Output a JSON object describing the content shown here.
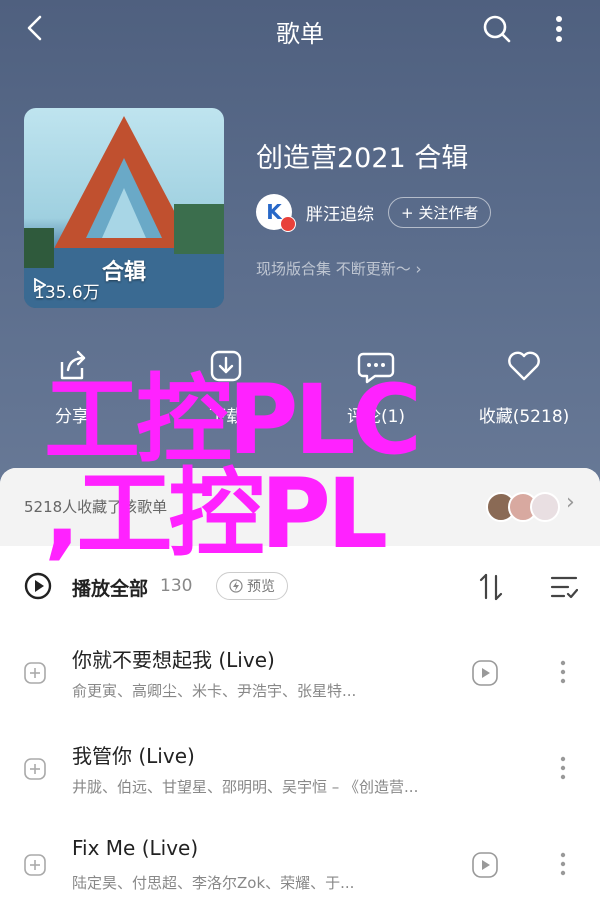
{
  "header": {
    "title": "歌单"
  },
  "album": {
    "title": "创造营2021 合辑",
    "cover_text": "合辑",
    "play_count": "135.6万",
    "creator": {
      "name": "胖汪追综",
      "avatar_letter": "K",
      "follow_label": "+ 关注作者"
    },
    "description": "现场版合集 不断更新～ ›"
  },
  "actions": [
    {
      "label": "分享",
      "icon": "share-icon"
    },
    {
      "label": "下载",
      "icon": "download-icon"
    },
    {
      "label": "评论(1)",
      "icon": "comment-icon"
    },
    {
      "label": "收藏(5218)",
      "icon": "heart-icon"
    }
  ],
  "collect_bar": {
    "text": "5218人收藏了该歌单",
    "arrow": "›"
  },
  "playall": {
    "label": "播放全部",
    "count": "130",
    "preview_label": "预览"
  },
  "songs": [
    {
      "title": "你就不要想起我 (Live)",
      "artists": "俞更寅、高卿尘、米卡、尹浩宇、张星特..."
    },
    {
      "title": "我管你 (Live)",
      "artists": "井胧、伯远、甘望星、邵明明、吴宇恒 – 《创造营..."
    },
    {
      "title": "Fix Me (Live)",
      "artists": "陆定昊、付思超、李洛尔Zok、荣耀、于..."
    }
  ],
  "watermark": {
    "line1": "工控PLC",
    "line2": ",工控PL"
  },
  "colors": {
    "header_bg": "#5b6d8c",
    "watermark": "#ff22ff",
    "badge": "#e8413a"
  }
}
